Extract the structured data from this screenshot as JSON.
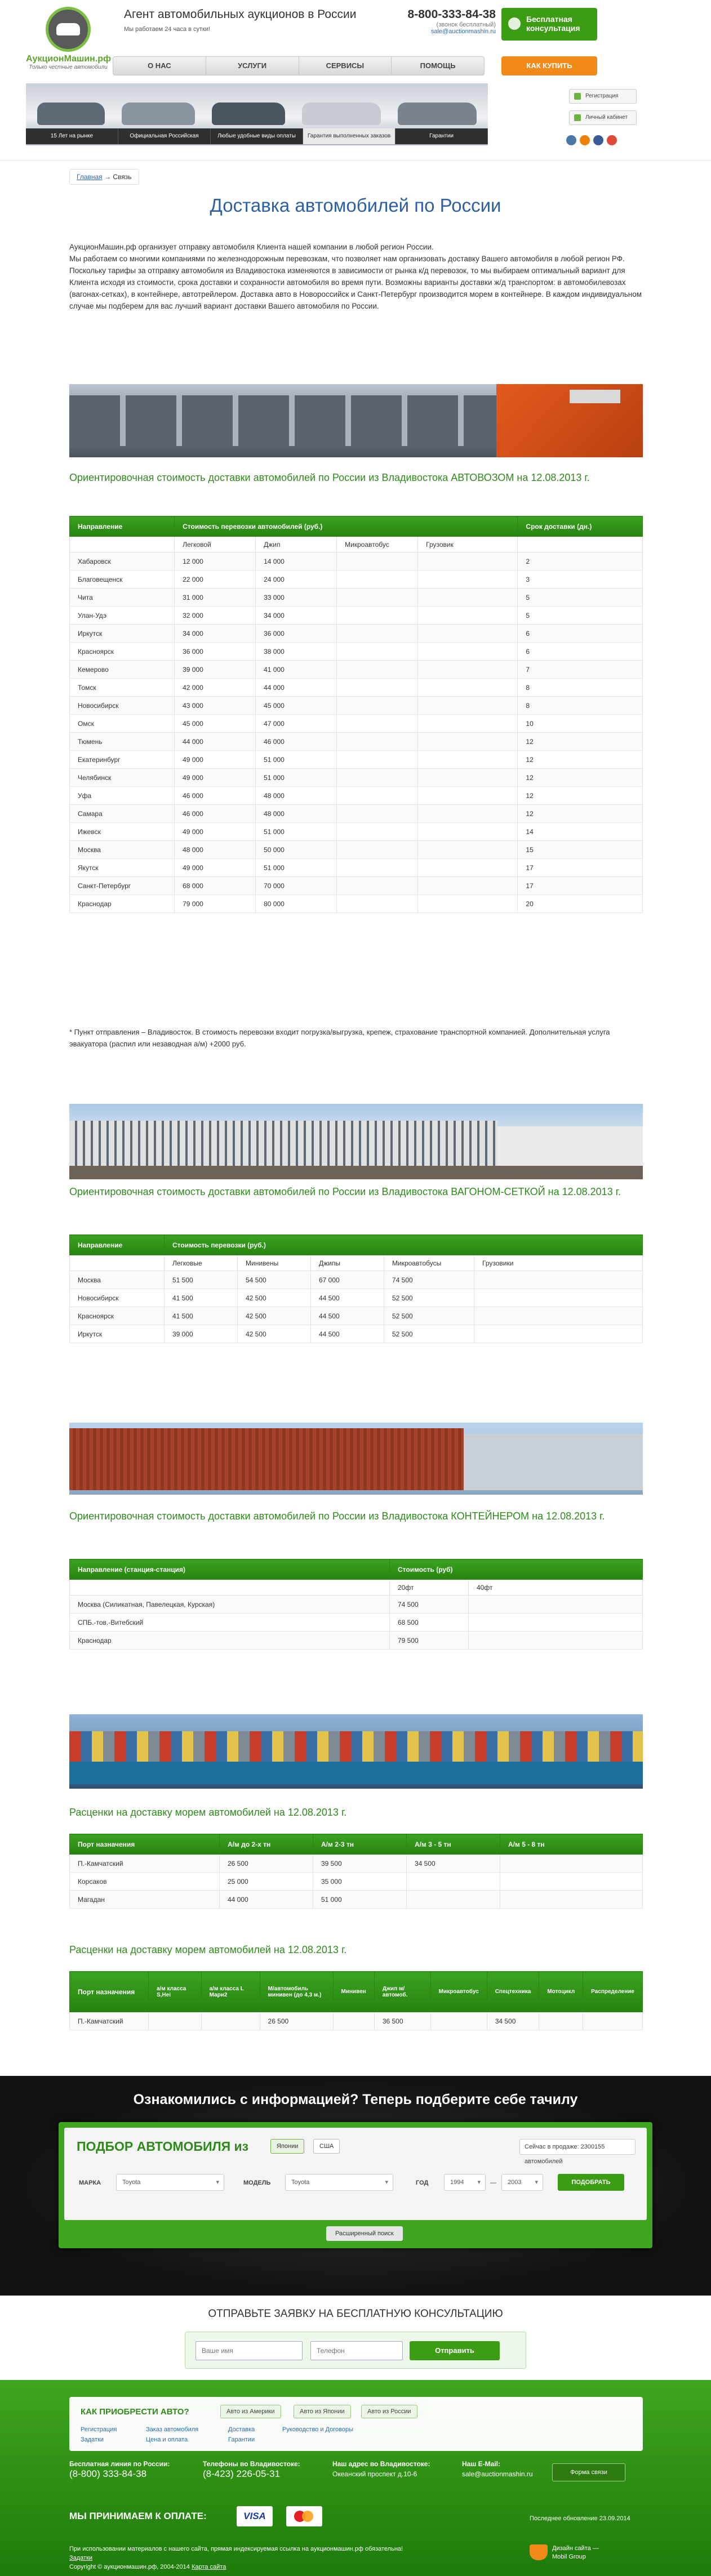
{
  "header": {
    "logo_name": "АукционМашин",
    "logo_domain": ".рф",
    "logo_tagline": "Только честные автомобили",
    "agent_title": "Агент автомобильных аукционов в России",
    "agent_sub1": "Мы работаем 24 часа в сутки!",
    "agent_sub2": "",
    "phone": "8-800-333-84-38",
    "phone_note": "(звонок бесплатный)",
    "email": "sale@auctionmashin.ru",
    "free_consult": "Бесплатная консультация",
    "buy_button": "КАК КУПИТЬ",
    "side_buttons": [
      "Регистрация",
      "Личный кабинет"
    ],
    "social_colors": [
      "#4a76a8",
      "#ee8208",
      "#3b5998",
      "#de4b39"
    ]
  },
  "nav": [
    "О НАС",
    "УСЛУГИ",
    "СЕРВИСЫ",
    "ПОМОЩЬ"
  ],
  "banner_strip": [
    "15 Лет на рынке",
    "Официальная Российская компания",
    "Любые удобные виды оплаты",
    "Гарантия выполненных заказов",
    "Гарантии"
  ],
  "breadcrumb": {
    "home": "Главная",
    "sep": "→",
    "current": "Связь"
  },
  "page_title": "Доставка автомобилей по России",
  "intro": [
    "АукционМашин.рф организует отправку автомобиля Клиента нашей компании в любой регион России.",
    "Мы работаем со многими компаниями по железнодорожным перевозкам, что позволяет нам организовать доставку Вашего автомобиля в любой регион РФ. Поскольку тарифы за отправку автомобиля из Владивостока изменяются в зависимости от рынка к/д перевозок, то мы выбираем оптимальный вариант для Клиента исходя из стоимости, срока доставки и сохранности автомобиля во время пути. Возможны варианты доставки ж/д транспортом: в автомобилевозах (вагонах-сетках), в контейнере, автотрейлером. Доставка авто в Новороссийск и Санкт-Петербург производится морем в контейнере. В каждом индивидуальном случае мы подберем для вас лучший вариант доставки Вашего автомобиля по России."
  ],
  "table1": {
    "title": "Ориентировочная стоимость доставки автомобилей по России из Владивостока АВТОВОЗОМ на 12.08.2013 г.",
    "h_dir": "Направление",
    "h_cost": "Стоимость перевозки автомобилей (руб.)",
    "h_term": "Срок доставки (дн.)",
    "sub": [
      "Легковой",
      "Джип",
      "Микроавтобус",
      "Грузовик"
    ],
    "rows": [
      [
        "Хабаровск",
        "12 000",
        "14 000",
        "",
        "",
        "2"
      ],
      [
        "Благовещенск",
        "22 000",
        "24 000",
        "",
        "",
        "3"
      ],
      [
        "Чита",
        "31 000",
        "33 000",
        "",
        "",
        "5"
      ],
      [
        "Улан-Удэ",
        "32 000",
        "34 000",
        "",
        "",
        "5"
      ],
      [
        "Иркутск",
        "34 000",
        "36 000",
        "",
        "",
        "6"
      ],
      [
        "Красноярск",
        "36 000",
        "38 000",
        "",
        "",
        "6"
      ],
      [
        "Кемерово",
        "39 000",
        "41 000",
        "",
        "",
        "7"
      ],
      [
        "Томск",
        "42 000",
        "44 000",
        "",
        "",
        "8"
      ],
      [
        "Новосибирск",
        "43 000",
        "45 000",
        "",
        "",
        "8"
      ],
      [
        "Омск",
        "45 000",
        "47 000",
        "",
        "",
        "10"
      ],
      [
        "Тюмень",
        "44 000",
        "46 000",
        "",
        "",
        "12"
      ],
      [
        "Екатеринбург",
        "49 000",
        "51 000",
        "",
        "",
        "12"
      ],
      [
        "Челябинск",
        "49 000",
        "51 000",
        "",
        "",
        "12"
      ],
      [
        "Уфа",
        "46 000",
        "48 000",
        "",
        "",
        "12"
      ],
      [
        "Самара",
        "46 000",
        "48 000",
        "",
        "",
        "12"
      ],
      [
        "Ижевск",
        "49 000",
        "51 000",
        "",
        "",
        "14"
      ],
      [
        "Москва",
        "48 000",
        "50 000",
        "",
        "",
        "15"
      ],
      [
        "Якутск",
        "49 000",
        "51 000",
        "",
        "",
        "17"
      ],
      [
        "Санкт-Петербург",
        "68 000",
        "70 000",
        "",
        "",
        "17"
      ],
      [
        "Краснодар",
        "79 000",
        "80 000",
        "",
        "",
        "20"
      ]
    ]
  },
  "note": "* Пункт отправления – Владивосток. В стоимость перевозки входит погрузка/выгрузка, крепеж, страхование транспортной компанией. Дополнительная услуга эвакуатора (распил или незаводная а/м) +2000 руб.",
  "table2": {
    "title": "Ориентировочная стоимость доставки автомобилей по России из Владивостока ВАГОНОМ-СЕТКОЙ на 12.08.2013 г.",
    "h_dir": "Направление",
    "h_cost": "Стоимость перевозки (руб.)",
    "sub": [
      "Легковые",
      "Минивены",
      "Джипы",
      "Микроавтобусы",
      "Грузовики"
    ],
    "rows": [
      [
        "Москва",
        "51 500",
        "54 500",
        "67 000",
        "74 500",
        ""
      ],
      [
        "Новосибирск",
        "41 500",
        "42 500",
        "44 500",
        "52 500",
        ""
      ],
      [
        "Красноярск",
        "41 500",
        "42 500",
        "44 500",
        "52 500",
        ""
      ],
      [
        "Иркутск",
        "39 000",
        "42 500",
        "44 500",
        "52 500",
        ""
      ]
    ]
  },
  "table3": {
    "title": "Ориентировочная стоимость доставки автомобилей по России из Владивостока КОНТЕЙНЕРОМ на 12.08.2013 г.",
    "h_dir": "Направление (станция-станция)",
    "h_cost": "Стоимость (руб)",
    "sub": [
      "20фт",
      "40фт"
    ],
    "rows": [
      [
        "Москва (Силикатная, Павелецкая, Курская)",
        "74 500",
        ""
      ],
      [
        "СПБ.-тов.-Витебский",
        "68 500",
        ""
      ],
      [
        "Краснодар",
        "79 500",
        ""
      ]
    ]
  },
  "table4": {
    "title": "Расценки на доставку морем автомобилей на 12.08.2013 г.",
    "head": [
      "Порт назначения",
      "А/м до 2-х тн",
      "А/м 2-3 тн",
      "А/м 3 - 5 тн",
      "А/м 5 - 8 тн"
    ],
    "rows": [
      [
        "П.-Камчатский",
        "26 500",
        "39 500",
        "34 500",
        ""
      ],
      [
        "Корсаков",
        "25 000",
        "35 000",
        "",
        ""
      ],
      [
        "Магадан",
        "44 000",
        "51 000",
        "",
        ""
      ]
    ]
  },
  "table5": {
    "title": "Расценки на доставку морем автомобилей на 12.08.2013 г.",
    "head": [
      "Порт назначения",
      "а/м класса S,Hei",
      "а/м класса L Мари2",
      "М/автомобиль минивен (до 4,3 м.)",
      "Минивен",
      "Джип м/автомоб.",
      "Микроавтобус",
      "Спецтехника",
      "Мотоцикл",
      "Распределение"
    ],
    "rows": [
      [
        "П.-Камчатский",
        "",
        "",
        "26 500",
        "",
        "36 500",
        "",
        "34 500",
        "",
        ""
      ]
    ]
  },
  "search": {
    "headline": "Ознакомились с информацией? Теперь подберите себе тачилу",
    "title": "ПОДБОР АВТОМОБИЛЯ из",
    "tab1": "Японии",
    "tab2": "США",
    "stock": "Сейчас в продаже: 2300155 автомобилей",
    "make_label": "МАРКА",
    "make_value": "Toyota",
    "model_label": "МОДЕЛЬ",
    "model_value": "Toyota",
    "year_label": "ГОД",
    "year_from": "1994",
    "year_sep": "—",
    "year_to": "2003",
    "go": "ПОДОБРАТЬ",
    "extended": "Расширенный поиск"
  },
  "consult": {
    "title": "ОТПРАВЬТЕ ЗАЯВКУ НА БЕСПЛАТНУЮ КОНСУЛЬТАЦИЮ",
    "name_ph": "Ваше имя",
    "phone_ph": "Телефон",
    "send": "Отправить"
  },
  "footer": {
    "how_title": "КАК ПРИОБРЕСТИ АВТО?",
    "pills": [
      "Авто из Америки",
      "Авто из Японии",
      "Авто из России"
    ],
    "links": [
      "Регистрация",
      "Заказ автомобиля",
      "Доставка",
      "Руководство и Договоры",
      "Задатки",
      "Цена и оплата",
      "Гарантии"
    ],
    "hotline_label": "Бесплатная линия по России:",
    "hotline": "(8-800) 333-84-38",
    "vl_label": "Телефоны во Владивостоке:",
    "vl_phone": "(8-423) 226-05-31",
    "addr_label": "Наш адрес во Владивостоке:",
    "addr": "Океанский проспект д.10-6",
    "mail_label": "Наш E-Mail:",
    "mail": "sale@auctionmashin.ru",
    "feedback": "Форма связи",
    "pay_title": "МЫ ПРИНИМАЕМ К ОПЛАТЕ:",
    "visa": "VISA",
    "updated": "Последнее обновление 23.09.2014",
    "legal1": "При использовании материалов с нашего сайта, прямая индексируемая ссылка на аукционмашин.рф обязательна!",
    "legal2": "Задатки",
    "legal3": "Copyright © аукционмашин.рф, 2004-2014",
    "legal4": "Карта сайта",
    "dev1": "Дизайн сайта —",
    "dev2": "Mobil Group"
  }
}
